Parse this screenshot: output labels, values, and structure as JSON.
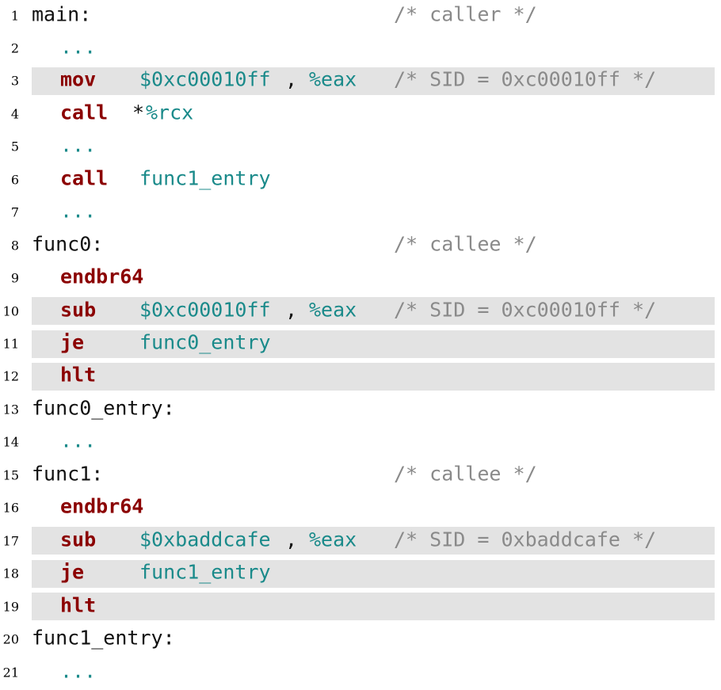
{
  "lines": [
    {
      "no": "1",
      "label": "main:",
      "comment": "/* caller */"
    },
    {
      "no": "2",
      "dots": "..."
    },
    {
      "no": "3",
      "mnemonic": "mov",
      "operand1": "$0xc00010ff",
      "comma": ",",
      "operand2": "%eax",
      "comment": "/* SID = 0xc00010ff */",
      "highlight": true
    },
    {
      "no": "4",
      "mnemonic": "call",
      "star": "*",
      "operand1": "%rcx"
    },
    {
      "no": "5",
      "dots": "..."
    },
    {
      "no": "6",
      "mnemonic": "call",
      "operand1": "func1_entry"
    },
    {
      "no": "7",
      "dots": "..."
    },
    {
      "no": "8",
      "label": "func0:",
      "comment": "/* callee */"
    },
    {
      "no": "9",
      "mnemonic": "endbr64"
    },
    {
      "no": "10",
      "mnemonic": "sub",
      "operand1": "$0xc00010ff",
      "comma": ",",
      "operand2": "%eax",
      "comment": "/* SID = 0xc00010ff */",
      "highlight": true
    },
    {
      "no": "11",
      "mnemonic": "je",
      "operand1": "func0_entry",
      "highlight": true
    },
    {
      "no": "12",
      "mnemonic": "hlt",
      "highlight": true
    },
    {
      "no": "13",
      "label": "func0_entry:"
    },
    {
      "no": "14",
      "dots": "..."
    },
    {
      "no": "15",
      "label": "func1:",
      "comment": "/* callee */"
    },
    {
      "no": "16",
      "mnemonic": "endbr64"
    },
    {
      "no": "17",
      "mnemonic": "sub",
      "operand1": "$0xbaddcafe",
      "comma": ",",
      "operand2": "%eax",
      "comment": "/* SID = 0xbaddcafe */",
      "highlight": true
    },
    {
      "no": "18",
      "mnemonic": "je",
      "operand1": "func1_entry",
      "highlight": true
    },
    {
      "no": "19",
      "mnemonic": "hlt",
      "highlight": true
    },
    {
      "no": "20",
      "label": "func1_entry:"
    },
    {
      "no": "21",
      "dots": "..."
    }
  ],
  "colors": {
    "mnemonic": "#8b0000",
    "operand": "#1a8a8a",
    "comment": "#8a8a8a",
    "highlight": "#e3e3e3"
  }
}
